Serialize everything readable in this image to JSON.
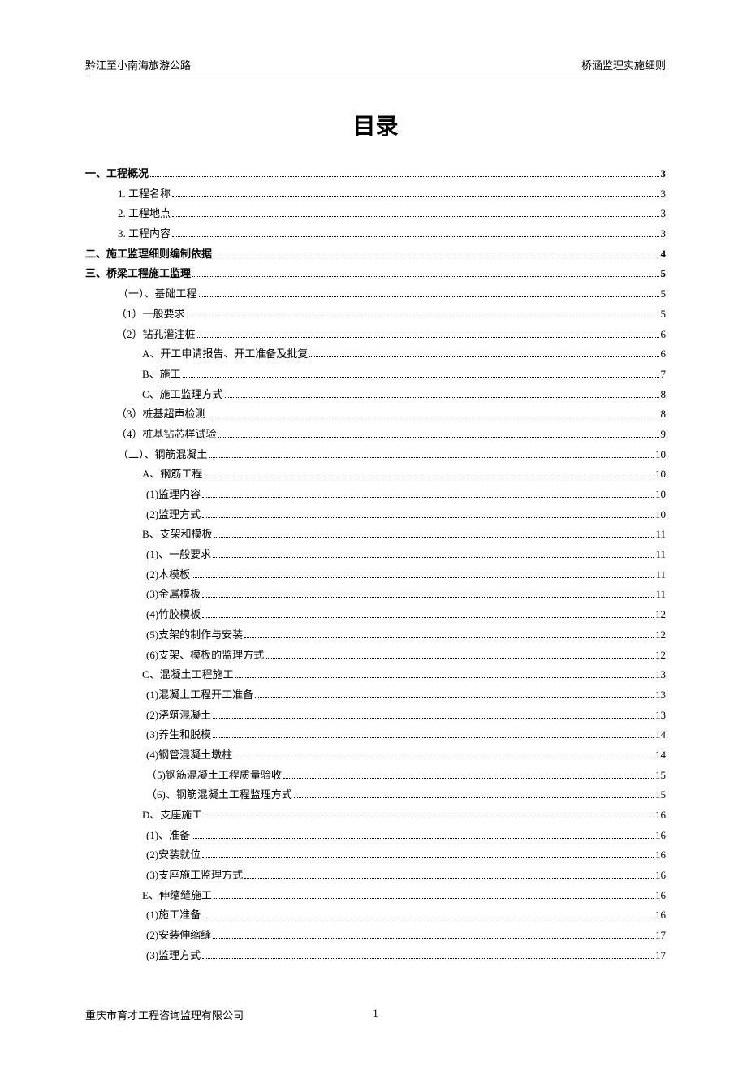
{
  "header": {
    "left": "黔江至小南海旅游公路",
    "right": "桥涵监理实施细则"
  },
  "title": "目录",
  "toc": [
    {
      "label": "一、工程概况",
      "page": "3",
      "bold": true,
      "indent": 0
    },
    {
      "label": "1. 工程名称",
      "page": "3",
      "bold": false,
      "indent": 1
    },
    {
      "label": "2. 工程地点",
      "page": "3",
      "bold": false,
      "indent": 1
    },
    {
      "label": "3. 工程内容",
      "page": "3",
      "bold": false,
      "indent": 1
    },
    {
      "label": "二、施工监理细则编制依据",
      "page": "4",
      "bold": true,
      "indent": 0
    },
    {
      "label": "三、桥梁工程施工监理",
      "page": "5",
      "bold": true,
      "indent": 0
    },
    {
      "label": "（一）、基础工程",
      "page": "5",
      "bold": false,
      "indent": 1
    },
    {
      "label": "（1）一般要求",
      "page": "5",
      "bold": false,
      "indent": 2
    },
    {
      "label": "（2）钻孔灌注桩",
      "page": "6",
      "bold": false,
      "indent": 2
    },
    {
      "label": "A、开工申请报告、开工准备及批复",
      "page": "6",
      "bold": false,
      "indent": 3
    },
    {
      "label": "B、施工",
      "page": "7",
      "bold": false,
      "indent": 3
    },
    {
      "label": "C、施工监理方式",
      "page": "8",
      "bold": false,
      "indent": 3
    },
    {
      "label": "（3）桩基超声检测",
      "page": "8",
      "bold": false,
      "indent": 2
    },
    {
      "label": "（4）桩基钻芯样试验",
      "page": "9",
      "bold": false,
      "indent": 2
    },
    {
      "label": "（二）、钢筋混凝土",
      "page": "10",
      "bold": false,
      "indent": 1
    },
    {
      "label": "A、钢筋工程",
      "page": "10",
      "bold": false,
      "indent": 3
    },
    {
      "label": "(1)监理内容",
      "page": "10",
      "bold": false,
      "indent": 4
    },
    {
      "label": "(2)监理方式",
      "page": "10",
      "bold": false,
      "indent": 4
    },
    {
      "label": "B、支架和模板",
      "page": "11",
      "bold": false,
      "indent": 3
    },
    {
      "label": "(1)、一般要求",
      "page": "11",
      "bold": false,
      "indent": 4
    },
    {
      "label": "(2)木模板",
      "page": "11",
      "bold": false,
      "indent": 4
    },
    {
      "label": "(3)金属模板",
      "page": "11",
      "bold": false,
      "indent": 4
    },
    {
      "label": "(4)竹胶模板",
      "page": "12",
      "bold": false,
      "indent": 4
    },
    {
      "label": "(5)支架的制作与安装",
      "page": "12",
      "bold": false,
      "indent": 4
    },
    {
      "label": "(6)支架、模板的监理方式",
      "page": "12",
      "bold": false,
      "indent": 4
    },
    {
      "label": "C、混凝土工程施工",
      "page": "13",
      "bold": false,
      "indent": 3
    },
    {
      "label": "(1)混凝土工程开工准备",
      "page": "13",
      "bold": false,
      "indent": 4
    },
    {
      "label": "(2)浇筑混凝土",
      "page": "13",
      "bold": false,
      "indent": 4
    },
    {
      "label": "(3)养生和脱模",
      "page": "14",
      "bold": false,
      "indent": 4
    },
    {
      "label": "(4)钢管混凝土墩柱",
      "page": "14",
      "bold": false,
      "indent": 4
    },
    {
      "label": "（5)钢筋混凝土工程质量验收",
      "page": "15",
      "bold": false,
      "indent": 4
    },
    {
      "label": "（6)、钢筋混凝土工程监理方式",
      "page": "15",
      "bold": false,
      "indent": 4
    },
    {
      "label": "D、支座施工",
      "page": "16",
      "bold": false,
      "indent": 3
    },
    {
      "label": "(1)、准备",
      "page": "16",
      "bold": false,
      "indent": 4
    },
    {
      "label": "(2)安装就位",
      "page": "16",
      "bold": false,
      "indent": 4
    },
    {
      "label": "(3)支座施工监理方式",
      "page": "16",
      "bold": false,
      "indent": 4
    },
    {
      "label": "E、伸缩缝施工",
      "page": "16",
      "bold": false,
      "indent": 3
    },
    {
      "label": "(1)施工准备",
      "page": "16",
      "bold": false,
      "indent": 4
    },
    {
      "label": "(2)安装伸缩缝",
      "page": "17",
      "bold": false,
      "indent": 4
    },
    {
      "label": "(3)监理方式",
      "page": "17",
      "bold": false,
      "indent": 4
    }
  ],
  "footer": {
    "left": "重庆市育才工程咨询监理有限公司",
    "page": "1"
  }
}
